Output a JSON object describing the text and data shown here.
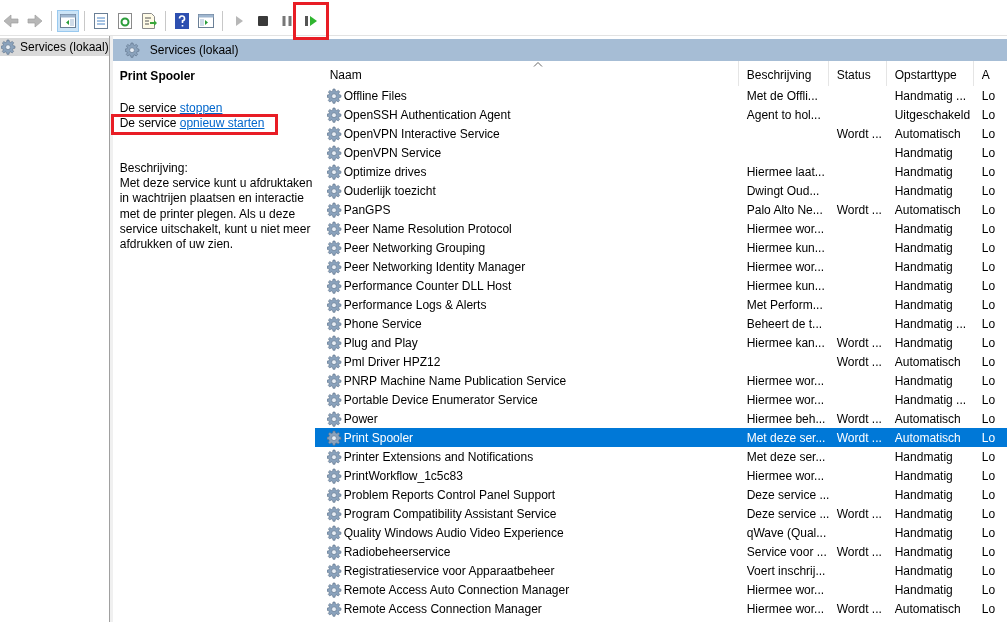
{
  "toolbar": [
    {
      "kind": "back",
      "disabled": true,
      "selected": false,
      "highlighted": false
    },
    {
      "kind": "forward",
      "disabled": true,
      "selected": false,
      "highlighted": false
    },
    {
      "kind": "sep"
    },
    {
      "kind": "tree",
      "disabled": false,
      "selected": true,
      "highlighted": false
    },
    {
      "kind": "sep"
    },
    {
      "kind": "properties",
      "disabled": false,
      "selected": false,
      "highlighted": false
    },
    {
      "kind": "refresh",
      "disabled": false,
      "selected": false,
      "highlighted": false
    },
    {
      "kind": "export",
      "disabled": false,
      "selected": false,
      "highlighted": false
    },
    {
      "kind": "sep"
    },
    {
      "kind": "help",
      "disabled": false,
      "selected": false,
      "highlighted": false
    },
    {
      "kind": "pane",
      "disabled": false,
      "selected": false,
      "highlighted": false
    },
    {
      "kind": "sep"
    },
    {
      "kind": "start",
      "disabled": true,
      "selected": false,
      "highlighted": false
    },
    {
      "kind": "stop",
      "disabled": false,
      "selected": false,
      "highlighted": false
    },
    {
      "kind": "pause",
      "disabled": false,
      "selected": false,
      "highlighted": false
    },
    {
      "kind": "resume",
      "disabled": false,
      "selected": false,
      "highlighted": true
    }
  ],
  "tree": {
    "items": [
      {
        "label": "Services (lokaal)",
        "selected": true
      }
    ]
  },
  "header": {
    "title": "Services (lokaal)"
  },
  "details": {
    "title": "Print Spooler",
    "actions": [
      {
        "prefix": "De service",
        "link": "stoppen",
        "highlighted": false
      },
      {
        "prefix": "De service",
        "link": "opnieuw starten",
        "highlighted": true
      }
    ],
    "description_label": "Beschrijving:",
    "description": "Met deze service kunt u afdruktaken in wachtrijen plaatsen en interactie met de printer plegen. Als u deze service uitschakelt, kunt u niet meer afdrukken of uw zien."
  },
  "table": {
    "columns": [
      "Naam",
      "Beschrijving",
      "Status",
      "Opstarttype",
      "A"
    ],
    "rows": [
      {
        "cells": [
          "Offline Files",
          "Met de Offli...",
          "",
          "Handmatig ...",
          "Lo"
        ],
        "selected": false
      },
      {
        "cells": [
          "OpenSSH Authentication Agent",
          "Agent to hol...",
          "",
          "Uitgeschakeld",
          "Lo"
        ],
        "selected": false
      },
      {
        "cells": [
          "OpenVPN Interactive Service",
          "",
          "Wordt ...",
          "Automatisch",
          "Lo"
        ],
        "selected": false
      },
      {
        "cells": [
          "OpenVPN Service",
          "",
          "",
          "Handmatig",
          "Lo"
        ],
        "selected": false
      },
      {
        "cells": [
          "Optimize drives",
          "Hiermee laat...",
          "",
          "Handmatig",
          "Lo"
        ],
        "selected": false
      },
      {
        "cells": [
          "Ouderlijk toezicht",
          "Dwingt Oud...",
          "",
          "Handmatig",
          "Lo"
        ],
        "selected": false
      },
      {
        "cells": [
          "PanGPS",
          "Palo Alto Ne...",
          "Wordt ...",
          "Automatisch",
          "Lo"
        ],
        "selected": false
      },
      {
        "cells": [
          "Peer Name Resolution Protocol",
          "Hiermee wor...",
          "",
          "Handmatig",
          "Lo"
        ],
        "selected": false
      },
      {
        "cells": [
          "Peer Networking Grouping",
          "Hiermee kun...",
          "",
          "Handmatig",
          "Lo"
        ],
        "selected": false
      },
      {
        "cells": [
          "Peer Networking Identity Manager",
          "Hiermee wor...",
          "",
          "Handmatig",
          "Lo"
        ],
        "selected": false
      },
      {
        "cells": [
          "Performance Counter DLL Host",
          "Hiermee kun...",
          "",
          "Handmatig",
          "Lo"
        ],
        "selected": false
      },
      {
        "cells": [
          "Performance Logs & Alerts",
          "Met Perform...",
          "",
          "Handmatig",
          "Lo"
        ],
        "selected": false
      },
      {
        "cells": [
          "Phone Service",
          "Beheert de t...",
          "",
          "Handmatig ...",
          "Lo"
        ],
        "selected": false
      },
      {
        "cells": [
          "Plug and Play",
          "Hiermee kan...",
          "Wordt ...",
          "Handmatig",
          "Lo"
        ],
        "selected": false
      },
      {
        "cells": [
          "Pml Driver HPZ12",
          "",
          "Wordt ...",
          "Automatisch",
          "Lo"
        ],
        "selected": false
      },
      {
        "cells": [
          "PNRP Machine Name Publication Service",
          "Hiermee wor...",
          "",
          "Handmatig",
          "Lo"
        ],
        "selected": false
      },
      {
        "cells": [
          "Portable Device Enumerator Service",
          "Hiermee wor...",
          "",
          "Handmatig ...",
          "Lo"
        ],
        "selected": false
      },
      {
        "cells": [
          "Power",
          "Hiermee beh...",
          "Wordt ...",
          "Automatisch",
          "Lo"
        ],
        "selected": false
      },
      {
        "cells": [
          "Print Spooler",
          "Met deze ser...",
          "Wordt ...",
          "Automatisch",
          "Lo"
        ],
        "selected": true
      },
      {
        "cells": [
          "Printer Extensions and Notifications",
          "Met deze ser...",
          "",
          "Handmatig",
          "Lo"
        ],
        "selected": false
      },
      {
        "cells": [
          "PrintWorkflow_1c5c83",
          "Hiermee wor...",
          "",
          "Handmatig",
          "Lo"
        ],
        "selected": false
      },
      {
        "cells": [
          "Problem Reports Control Panel Support",
          "Deze service ...",
          "",
          "Handmatig",
          "Lo"
        ],
        "selected": false
      },
      {
        "cells": [
          "Program Compatibility Assistant Service",
          "Deze service ...",
          "Wordt ...",
          "Handmatig",
          "Lo"
        ],
        "selected": false
      },
      {
        "cells": [
          "Quality Windows Audio Video Experience",
          "qWave (Qual...",
          "",
          "Handmatig",
          "Lo"
        ],
        "selected": false
      },
      {
        "cells": [
          "Radiobeheerservice",
          "Service voor ...",
          "Wordt ...",
          "Handmatig",
          "Lo"
        ],
        "selected": false
      },
      {
        "cells": [
          "Registratieservice voor Apparaatbeheer",
          "Voert inschrij...",
          "",
          "Handmatig",
          "Lo"
        ],
        "selected": false
      },
      {
        "cells": [
          "Remote Access Auto Connection Manager",
          "Hiermee wor...",
          "",
          "Handmatig",
          "Lo"
        ],
        "selected": false
      },
      {
        "cells": [
          "Remote Access Connection Manager",
          "Hiermee wor...",
          "Wordt ...",
          "Automatisch",
          "Lo"
        ],
        "selected": false
      }
    ]
  }
}
